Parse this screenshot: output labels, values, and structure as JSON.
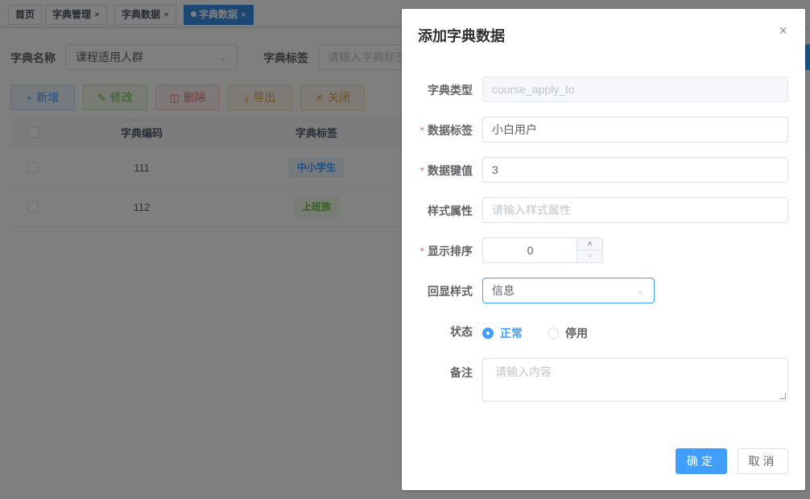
{
  "tags": [
    {
      "label": "首页",
      "closable": false
    },
    {
      "label": "字典管理",
      "closable": true
    },
    {
      "label": "字典数据",
      "closable": true
    },
    {
      "label": "字典数据",
      "closable": true,
      "active": true
    }
  ],
  "close_glyph": "×",
  "search": {
    "dict_name_label": "字典名称",
    "dict_name_value": "课程适用人群",
    "dict_label_label": "字典标签",
    "dict_label_placeholder": "请输入字典标签"
  },
  "toolbar": {
    "add": "新增",
    "edit": "修改",
    "delete": "删除",
    "export": "导出",
    "close": "关闭"
  },
  "table": {
    "columns": [
      "字典编码",
      "字典标签"
    ],
    "rows": [
      {
        "code": "111",
        "label": "中小学生",
        "label_style": "blue"
      },
      {
        "code": "112",
        "label": "上班族",
        "label_style": "green"
      }
    ]
  },
  "dialog": {
    "title": "添加字典数据",
    "fields": {
      "dict_type": {
        "label": "字典类型",
        "value": "course_apply_to",
        "disabled": true
      },
      "data_label": {
        "label": "数据标签",
        "value": "小白用户",
        "required": true
      },
      "data_value": {
        "label": "数据键值",
        "value": "3",
        "required": true
      },
      "css_class": {
        "label": "样式属性",
        "placeholder": "请输入样式属性"
      },
      "sort": {
        "label": "显示排序",
        "value": "0",
        "required": true
      },
      "list_class": {
        "label": "回显样式",
        "value": "信息"
      },
      "status": {
        "label": "状态",
        "options": [
          "正常",
          "停用"
        ],
        "selected": "正常"
      },
      "remark": {
        "label": "备注",
        "placeholder": "请输入内容"
      }
    },
    "confirm": "确定",
    "cancel": "取消"
  },
  "colors": {
    "primary": "#409eff",
    "success": "#67c23a",
    "danger": "#f56c6c",
    "warning": "#e6a23c",
    "active_tag": "#3a8ee6"
  },
  "icons": {
    "add": "plus-icon",
    "edit": "edit-icon",
    "delete": "trash-icon",
    "export": "download-icon",
    "close": "close-icon"
  }
}
